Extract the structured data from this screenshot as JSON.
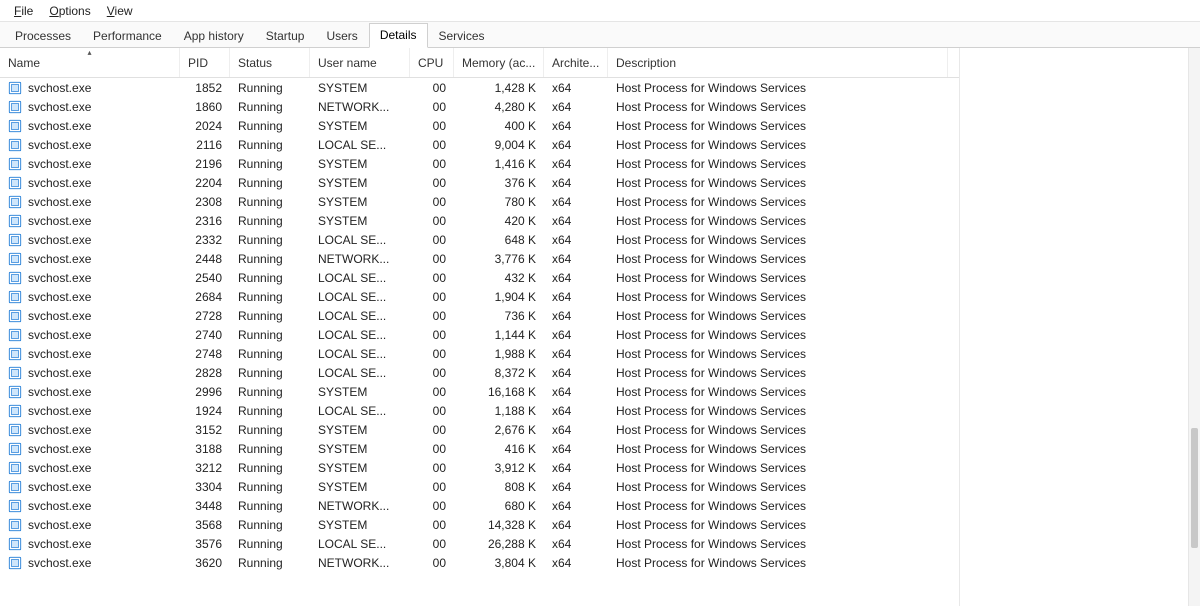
{
  "menubar": [
    {
      "label": "File",
      "accel_index": 0
    },
    {
      "label": "Options",
      "accel_index": 0
    },
    {
      "label": "View",
      "accel_index": 0
    }
  ],
  "tabs": [
    {
      "label": "Processes",
      "active": false
    },
    {
      "label": "Performance",
      "active": false
    },
    {
      "label": "App history",
      "active": false
    },
    {
      "label": "Startup",
      "active": false
    },
    {
      "label": "Users",
      "active": false
    },
    {
      "label": "Details",
      "active": true
    },
    {
      "label": "Services",
      "active": false
    }
  ],
  "columns": [
    {
      "key": "name",
      "label": "Name",
      "cls": "c-name",
      "sorted": true,
      "sort_dir": "asc"
    },
    {
      "key": "pid",
      "label": "PID",
      "cls": "c-pid"
    },
    {
      "key": "status",
      "label": "Status",
      "cls": "c-status"
    },
    {
      "key": "user",
      "label": "User name",
      "cls": "c-user"
    },
    {
      "key": "cpu",
      "label": "CPU",
      "cls": "c-cpu"
    },
    {
      "key": "mem",
      "label": "Memory (ac...",
      "cls": "c-mem"
    },
    {
      "key": "arch",
      "label": "Archite...",
      "cls": "c-arch"
    },
    {
      "key": "desc",
      "label": "Description",
      "cls": "c-desc"
    }
  ],
  "icon_colors": {
    "border": "#1e7bd6",
    "fill": "#cfe6fb"
  },
  "rows": [
    {
      "name": "svchost.exe",
      "pid": "1852",
      "status": "Running",
      "user": "SYSTEM",
      "cpu": "00",
      "mem": "1,428 K",
      "arch": "x64",
      "desc": "Host Process for Windows Services"
    },
    {
      "name": "svchost.exe",
      "pid": "1860",
      "status": "Running",
      "user": "NETWORK...",
      "cpu": "00",
      "mem": "4,280 K",
      "arch": "x64",
      "desc": "Host Process for Windows Services"
    },
    {
      "name": "svchost.exe",
      "pid": "2024",
      "status": "Running",
      "user": "SYSTEM",
      "cpu": "00",
      "mem": "400 K",
      "arch": "x64",
      "desc": "Host Process for Windows Services"
    },
    {
      "name": "svchost.exe",
      "pid": "2116",
      "status": "Running",
      "user": "LOCAL SE...",
      "cpu": "00",
      "mem": "9,004 K",
      "arch": "x64",
      "desc": "Host Process for Windows Services"
    },
    {
      "name": "svchost.exe",
      "pid": "2196",
      "status": "Running",
      "user": "SYSTEM",
      "cpu": "00",
      "mem": "1,416 K",
      "arch": "x64",
      "desc": "Host Process for Windows Services"
    },
    {
      "name": "svchost.exe",
      "pid": "2204",
      "status": "Running",
      "user": "SYSTEM",
      "cpu": "00",
      "mem": "376 K",
      "arch": "x64",
      "desc": "Host Process for Windows Services"
    },
    {
      "name": "svchost.exe",
      "pid": "2308",
      "status": "Running",
      "user": "SYSTEM",
      "cpu": "00",
      "mem": "780 K",
      "arch": "x64",
      "desc": "Host Process for Windows Services"
    },
    {
      "name": "svchost.exe",
      "pid": "2316",
      "status": "Running",
      "user": "SYSTEM",
      "cpu": "00",
      "mem": "420 K",
      "arch": "x64",
      "desc": "Host Process for Windows Services"
    },
    {
      "name": "svchost.exe",
      "pid": "2332",
      "status": "Running",
      "user": "LOCAL SE...",
      "cpu": "00",
      "mem": "648 K",
      "arch": "x64",
      "desc": "Host Process for Windows Services"
    },
    {
      "name": "svchost.exe",
      "pid": "2448",
      "status": "Running",
      "user": "NETWORK...",
      "cpu": "00",
      "mem": "3,776 K",
      "arch": "x64",
      "desc": "Host Process for Windows Services"
    },
    {
      "name": "svchost.exe",
      "pid": "2540",
      "status": "Running",
      "user": "LOCAL SE...",
      "cpu": "00",
      "mem": "432 K",
      "arch": "x64",
      "desc": "Host Process for Windows Services"
    },
    {
      "name": "svchost.exe",
      "pid": "2684",
      "status": "Running",
      "user": "LOCAL SE...",
      "cpu": "00",
      "mem": "1,904 K",
      "arch": "x64",
      "desc": "Host Process for Windows Services"
    },
    {
      "name": "svchost.exe",
      "pid": "2728",
      "status": "Running",
      "user": "LOCAL SE...",
      "cpu": "00",
      "mem": "736 K",
      "arch": "x64",
      "desc": "Host Process for Windows Services"
    },
    {
      "name": "svchost.exe",
      "pid": "2740",
      "status": "Running",
      "user": "LOCAL SE...",
      "cpu": "00",
      "mem": "1,144 K",
      "arch": "x64",
      "desc": "Host Process for Windows Services"
    },
    {
      "name": "svchost.exe",
      "pid": "2748",
      "status": "Running",
      "user": "LOCAL SE...",
      "cpu": "00",
      "mem": "1,988 K",
      "arch": "x64",
      "desc": "Host Process for Windows Services"
    },
    {
      "name": "svchost.exe",
      "pid": "2828",
      "status": "Running",
      "user": "LOCAL SE...",
      "cpu": "00",
      "mem": "8,372 K",
      "arch": "x64",
      "desc": "Host Process for Windows Services"
    },
    {
      "name": "svchost.exe",
      "pid": "2996",
      "status": "Running",
      "user": "SYSTEM",
      "cpu": "00",
      "mem": "16,168 K",
      "arch": "x64",
      "desc": "Host Process for Windows Services"
    },
    {
      "name": "svchost.exe",
      "pid": "1924",
      "status": "Running",
      "user": "LOCAL SE...",
      "cpu": "00",
      "mem": "1,188 K",
      "arch": "x64",
      "desc": "Host Process for Windows Services"
    },
    {
      "name": "svchost.exe",
      "pid": "3152",
      "status": "Running",
      "user": "SYSTEM",
      "cpu": "00",
      "mem": "2,676 K",
      "arch": "x64",
      "desc": "Host Process for Windows Services"
    },
    {
      "name": "svchost.exe",
      "pid": "3188",
      "status": "Running",
      "user": "SYSTEM",
      "cpu": "00",
      "mem": "416 K",
      "arch": "x64",
      "desc": "Host Process for Windows Services"
    },
    {
      "name": "svchost.exe",
      "pid": "3212",
      "status": "Running",
      "user": "SYSTEM",
      "cpu": "00",
      "mem": "3,912 K",
      "arch": "x64",
      "desc": "Host Process for Windows Services"
    },
    {
      "name": "svchost.exe",
      "pid": "3304",
      "status": "Running",
      "user": "SYSTEM",
      "cpu": "00",
      "mem": "808 K",
      "arch": "x64",
      "desc": "Host Process for Windows Services"
    },
    {
      "name": "svchost.exe",
      "pid": "3448",
      "status": "Running",
      "user": "NETWORK...",
      "cpu": "00",
      "mem": "680 K",
      "arch": "x64",
      "desc": "Host Process for Windows Services"
    },
    {
      "name": "svchost.exe",
      "pid": "3568",
      "status": "Running",
      "user": "SYSTEM",
      "cpu": "00",
      "mem": "14,328 K",
      "arch": "x64",
      "desc": "Host Process for Windows Services"
    },
    {
      "name": "svchost.exe",
      "pid": "3576",
      "status": "Running",
      "user": "LOCAL SE...",
      "cpu": "00",
      "mem": "26,288 K",
      "arch": "x64",
      "desc": "Host Process for Windows Services"
    },
    {
      "name": "svchost.exe",
      "pid": "3620",
      "status": "Running",
      "user": "NETWORK...",
      "cpu": "00",
      "mem": "3,804 K",
      "arch": "x64",
      "desc": "Host Process for Windows Services"
    }
  ]
}
